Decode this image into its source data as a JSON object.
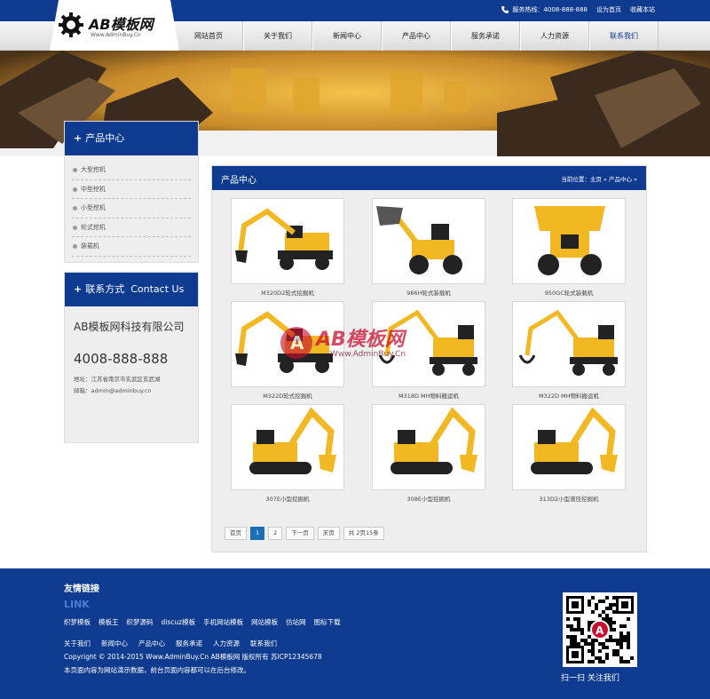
{
  "topbar": {
    "hotline": "服务热线：4008-888-888",
    "set_home": "设为首页",
    "bookmark": "收藏本站"
  },
  "logo": {
    "title": "AB模板网",
    "subtitle": "Www.AdminBuy.Cn"
  },
  "nav": {
    "items": [
      "网站首页",
      "关于我们",
      "新闻中心",
      "产品中心",
      "服务承诺",
      "人力资源",
      "联系我们"
    ]
  },
  "sidebar": {
    "products_title": "产品中心",
    "products": [
      "大型挖机",
      "中型挖机",
      "小型挖机",
      "轮式挖机",
      "装载机"
    ],
    "contact_title": "联系方式",
    "contact_title_en": "Contact Us",
    "company": "AB模板网科技有限公司",
    "phone": "4008-888-888",
    "address": "地址：江苏省南京市玄武区玄武湖",
    "email": "邮箱：admin@adminbuy.cn"
  },
  "main": {
    "title": "产品中心",
    "breadcrumb": "当前位置：主页 » 产品中心 »",
    "products": [
      {
        "caption": "M320D2轮式挖掘机",
        "kind": "wheeled-excavator"
      },
      {
        "caption": "986H轮式装载机",
        "kind": "loader-lift"
      },
      {
        "caption": "950GC轮式装载机",
        "kind": "loader-front"
      },
      {
        "caption": "M322D轮式挖掘机",
        "kind": "wheeled-excavator"
      },
      {
        "caption": "M318D MH物料搬运机",
        "kind": "material-handler"
      },
      {
        "caption": "M322D MH物料搬运机",
        "kind": "material-handler"
      },
      {
        "caption": "307E小型挖掘机",
        "kind": "crawler-excavator"
      },
      {
        "caption": "308E小型挖掘机",
        "kind": "crawler-excavator"
      },
      {
        "caption": "313D2小型液压挖掘机",
        "kind": "crawler-excavator"
      }
    ],
    "pager": {
      "first": "首页",
      "p1": "1",
      "p2": "2",
      "next": "下一页",
      "last": "末页",
      "summary": "共 2页15条"
    }
  },
  "watermark": {
    "title": "AB模板网",
    "url": "Www.AdminBuy.Cn"
  },
  "footer": {
    "links_title": "友情链接",
    "links_en": "LINK",
    "links": [
      "织梦模板",
      "模板王",
      "织梦源码",
      "discuz模板",
      "手机网站模板",
      "网站模板",
      "仿站网",
      "图标下载"
    ],
    "nav": [
      "关于我们",
      "新闻中心",
      "产品中心",
      "服务承诺",
      "人力资源",
      "联系我们"
    ],
    "copyright": "Copyright © 2014-2015 Www.AdminBuy.Cn AB模板网 版权所有 苏ICP12345678",
    "note": "本页面内容为网站演示数据，前台页面内容都可以在后台修改。",
    "qr_caption": "扫一扫   关注我们"
  },
  "colors": {
    "brand_blue": "#0e3a8f",
    "machine_yellow": "#f2b823",
    "pager_active": "#1c6fb5"
  }
}
